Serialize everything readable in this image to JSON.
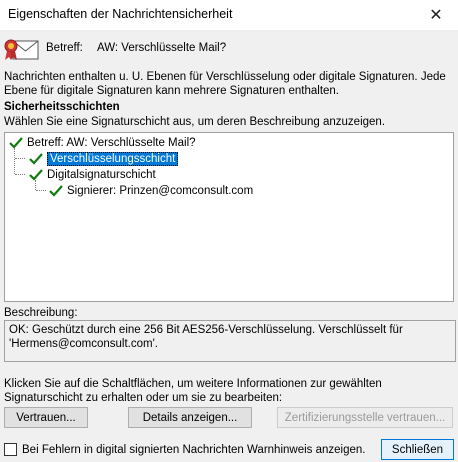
{
  "window": {
    "title": "Eigenschaften der Nachrichtensicherheit"
  },
  "subject": {
    "label": "Betreff:",
    "value": "AW: Verschlüsselte Mail?"
  },
  "intro": "Nachrichten enthalten u. U. Ebenen für Verschlüsselung oder digitale Signaturen. Jede Ebene für digitale Signaturen kann mehrere Signaturen enthalten.",
  "layers": {
    "heading": "Sicherheitsschichten",
    "instruction": "Wählen Sie eine Signaturschicht aus, um deren Beschreibung anzuzeigen.",
    "tree": {
      "root": "Betreff: AW: Verschlüsselte Mail?",
      "encryption": "Verschlüsselungsschicht",
      "signature_layer": "Digitalsignaturschicht",
      "signer": "Signierer: Prinzen@comconsult.com"
    }
  },
  "description": {
    "label": "Beschreibung:",
    "text": "OK: Geschützt durch eine 256 Bit AES256-Verschlüsselung. Verschlüsselt für 'Hermens@comconsult.com'."
  },
  "hint": "Klicken Sie auf die Schaltflächen, um weitere Informationen zur gewählten Signaturschicht zu erhalten oder um sie zu bearbeiten:",
  "buttons": {
    "trust": "Vertrauen...",
    "details": "Details anzeigen...",
    "ca_trust": "Zertifizierungsstelle vertrauen...",
    "close": "Schließen"
  },
  "warning_checkbox": {
    "label": "Bei Fehlern in digital signierten Nachrichten Warnhinweis anzeigen.",
    "checked": false
  },
  "colors": {
    "selection": "#0078d7",
    "check": "#107c10"
  },
  "icons": {
    "close": "close-icon",
    "certificate": "certificate-envelope-icon",
    "check": "checkmark-icon"
  }
}
